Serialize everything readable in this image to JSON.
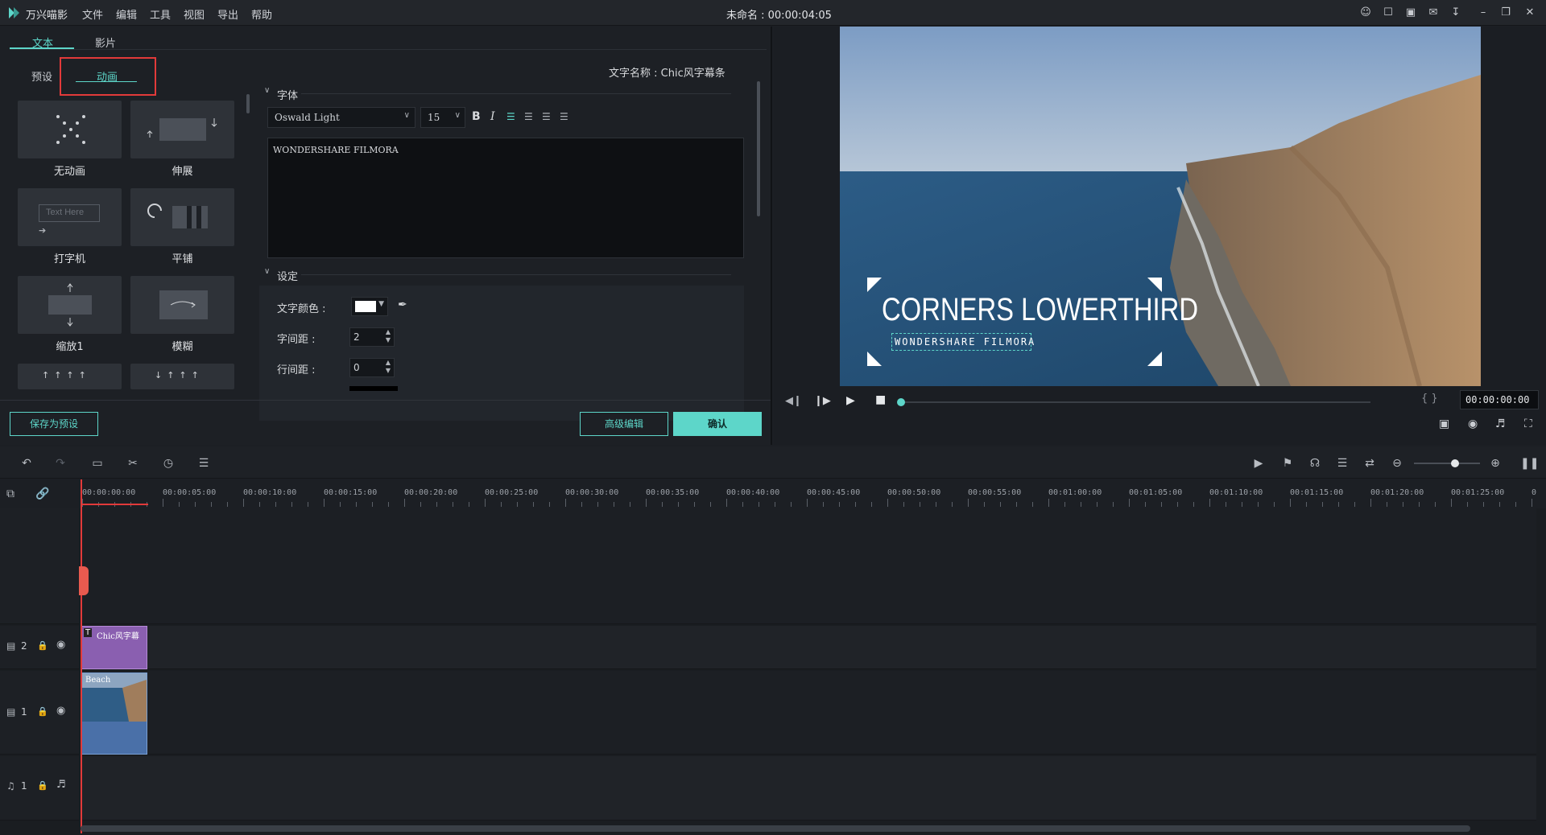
{
  "titlebar": {
    "app_name": "万兴喵影",
    "menus": [
      "文件",
      "编辑",
      "工具",
      "视图",
      "导出",
      "帮助"
    ],
    "document_title": "未命名 : 00:00:04:05"
  },
  "panel": {
    "tabs": [
      "文本",
      "影片"
    ],
    "subtabs": [
      "预设",
      "动画"
    ],
    "text_name_label": "文字名称 : Chic风字幕条",
    "animations": [
      {
        "label": "无动画"
      },
      {
        "label": "伸展"
      },
      {
        "label": "打字机",
        "thumb_text": "Text Here"
      },
      {
        "label": "平铺"
      },
      {
        "label": "缩放1"
      },
      {
        "label": "模糊"
      }
    ],
    "font_section": "字体",
    "font_name": "Oswald Light",
    "font_size": "15",
    "bold": "B",
    "italic": "I",
    "text_content": "WONDERSHARE FILMORA",
    "settings_section": "设定",
    "text_color_label": "文字颜色 :",
    "letter_spacing_label": "字间距 :",
    "letter_spacing_value": "2",
    "line_spacing_label": "行间距 :",
    "line_spacing_value": "0",
    "save_preset": "保存为预设",
    "advanced_edit": "高级编辑",
    "confirm": "确认",
    "accent": "#5dd6c9"
  },
  "preview": {
    "title_text": "CORNERS LOWERTHIRD",
    "subtitle_text": "WONDERSHARE FILMORA",
    "timecode": "00:00:00:00",
    "brackets": "{ }"
  },
  "timeline": {
    "ruler": [
      "00:00:00:00",
      "00:00:05:00",
      "00:00:10:00",
      "00:00:15:00",
      "00:00:20:00",
      "00:00:25:00",
      "00:00:30:00",
      "00:00:35:00",
      "00:00:40:00",
      "00:00:45:00",
      "00:00:50:00",
      "00:00:55:00",
      "00:01:00:00",
      "00:01:05:00",
      "00:01:10:00",
      "00:01:15:00",
      "00:01:20:00",
      "00:01:25:00",
      "0"
    ],
    "tracks": [
      {
        "label": "2",
        "clip": "Chic风字幕"
      },
      {
        "label": "1",
        "clip": "Beach"
      },
      {
        "label": "1"
      }
    ]
  }
}
